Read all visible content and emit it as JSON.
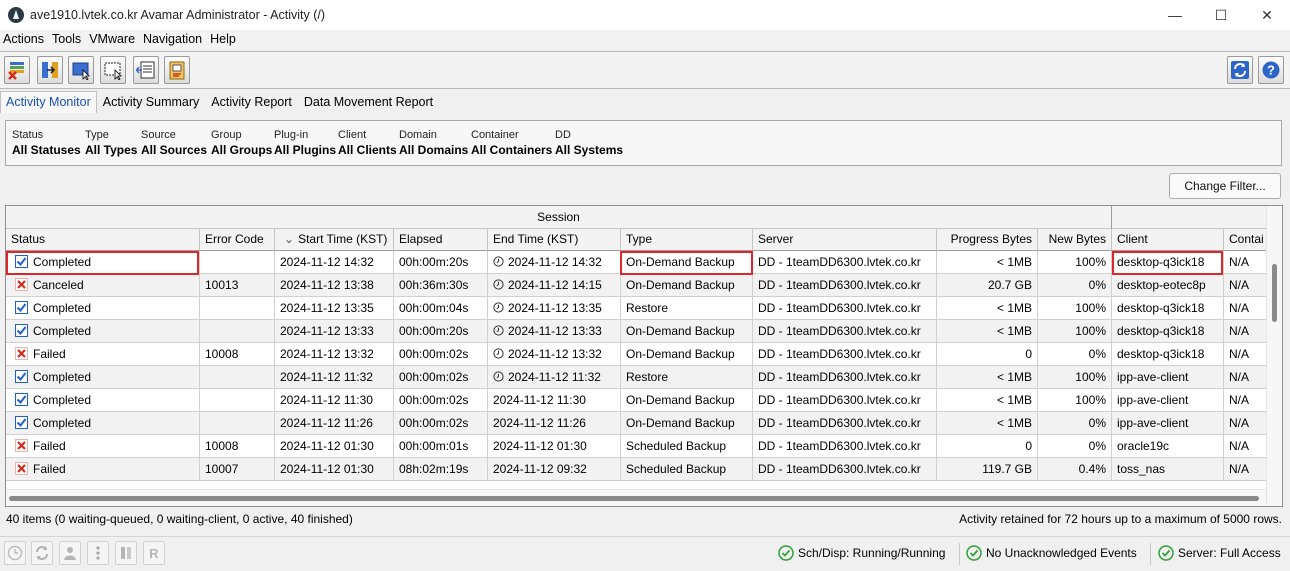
{
  "window": {
    "title": "ave1910.lvtek.co.kr Avamar Administrator - Activity (/)",
    "controls": {
      "minimize": "—",
      "maximize": "☐",
      "close": "✕"
    }
  },
  "menu": [
    "Actions",
    "Tools",
    "VMware",
    "Navigation",
    "Help"
  ],
  "toolbar": {
    "icons": [
      "cancel-activity-icon",
      "activity-details-icon",
      "select-all-icon",
      "select-none-icon",
      "session-log-icon",
      "get-log-icon",
      "refresh-icon",
      "help-icon"
    ]
  },
  "tabs": [
    "Activity Monitor",
    "Activity Summary",
    "Activity Report",
    "Data Movement Report"
  ],
  "filter": [
    {
      "label": "Status",
      "value": "All Statuses"
    },
    {
      "label": "Type",
      "value": "All Types"
    },
    {
      "label": "Source",
      "value": "All Sources"
    },
    {
      "label": "Group",
      "value": "All Groups"
    },
    {
      "label": "Plug-in",
      "value": "All Plugins"
    },
    {
      "label": "Client",
      "value": "All Clients"
    },
    {
      "label": "Domain",
      "value": "All Domains"
    },
    {
      "label": "Container",
      "value": "All Containers"
    },
    {
      "label": "DD",
      "value": "All Systems"
    }
  ],
  "change_filter_label": "Change Filter...",
  "table": {
    "group_header": "Session",
    "sort_indicator": "⌄",
    "columns": [
      "Status",
      "Error Code",
      "Start Time (KST)",
      "Elapsed",
      "End Time (KST)",
      "Type",
      "Server",
      "Progress Bytes",
      "New Bytes",
      "Client",
      "Contai"
    ],
    "rows": [
      {
        "status": "Completed",
        "icon": "check",
        "error": "",
        "start": "2024-11-12 14:32",
        "elapsed": "00h:00m:20s",
        "end": "2024-11-12 14:32",
        "clock": true,
        "type": "On-Demand Backup",
        "server": "DD - 1teamDD6300.lvtek.co.kr",
        "progress": "< 1MB",
        "newbytes": "100%",
        "client": "desktop-q3ick18",
        "container": "N/A"
      },
      {
        "status": "Canceled",
        "icon": "x",
        "error": "10013",
        "start": "2024-11-12 13:38",
        "elapsed": "00h:36m:30s",
        "end": "2024-11-12 14:15",
        "clock": true,
        "type": "On-Demand Backup",
        "server": "DD - 1teamDD6300.lvtek.co.kr",
        "progress": "20.7 GB",
        "newbytes": "0%",
        "client": "desktop-eotec8p",
        "container": "N/A"
      },
      {
        "status": "Completed",
        "icon": "check",
        "error": "",
        "start": "2024-11-12 13:35",
        "elapsed": "00h:00m:04s",
        "end": "2024-11-12 13:35",
        "clock": true,
        "type": "Restore",
        "server": "DD - 1teamDD6300.lvtek.co.kr",
        "progress": "< 1MB",
        "newbytes": "100%",
        "client": "desktop-q3ick18",
        "container": "N/A"
      },
      {
        "status": "Completed",
        "icon": "check",
        "error": "",
        "start": "2024-11-12 13:33",
        "elapsed": "00h:00m:20s",
        "end": "2024-11-12 13:33",
        "clock": true,
        "type": "On-Demand Backup",
        "server": "DD - 1teamDD6300.lvtek.co.kr",
        "progress": "< 1MB",
        "newbytes": "100%",
        "client": "desktop-q3ick18",
        "container": "N/A"
      },
      {
        "status": "Failed",
        "icon": "x",
        "error": "10008",
        "start": "2024-11-12 13:32",
        "elapsed": "00h:00m:02s",
        "end": "2024-11-12 13:32",
        "clock": true,
        "type": "On-Demand Backup",
        "server": "DD - 1teamDD6300.lvtek.co.kr",
        "progress": "0",
        "newbytes": "0%",
        "client": "desktop-q3ick18",
        "container": "N/A"
      },
      {
        "status": "Completed",
        "icon": "check",
        "error": "",
        "start": "2024-11-12 11:32",
        "elapsed": "00h:00m:02s",
        "end": "2024-11-12 11:32",
        "clock": true,
        "type": "Restore",
        "server": "DD - 1teamDD6300.lvtek.co.kr",
        "progress": "< 1MB",
        "newbytes": "100%",
        "client": "ipp-ave-client",
        "container": "N/A"
      },
      {
        "status": "Completed",
        "icon": "check",
        "error": "",
        "start": "2024-11-12 11:30",
        "elapsed": "00h:00m:02s",
        "end": "2024-11-12 11:30",
        "clock": false,
        "type": "On-Demand Backup",
        "server": "DD - 1teamDD6300.lvtek.co.kr",
        "progress": "< 1MB",
        "newbytes": "100%",
        "client": "ipp-ave-client",
        "container": "N/A"
      },
      {
        "status": "Completed",
        "icon": "check",
        "error": "",
        "start": "2024-11-12 11:26",
        "elapsed": "00h:00m:02s",
        "end": "2024-11-12 11:26",
        "clock": false,
        "type": "On-Demand Backup",
        "server": "DD - 1teamDD6300.lvtek.co.kr",
        "progress": "< 1MB",
        "newbytes": "0%",
        "client": "ipp-ave-client",
        "container": "N/A"
      },
      {
        "status": "Failed",
        "icon": "x",
        "error": "10008",
        "start": "2024-11-12 01:30",
        "elapsed": "00h:00m:01s",
        "end": "2024-11-12 01:30",
        "clock": false,
        "type": "Scheduled Backup",
        "server": "DD - 1teamDD6300.lvtek.co.kr",
        "progress": "0",
        "newbytes": "0%",
        "client": "oracle19c",
        "container": "N/A"
      },
      {
        "status": "Failed",
        "icon": "x",
        "error": "10007",
        "start": "2024-11-12 01:30",
        "elapsed": "08h:02m:19s",
        "end": "2024-11-12 09:32",
        "clock": false,
        "type": "Scheduled Backup",
        "server": "DD - 1teamDD6300.lvtek.co.kr",
        "progress": "119.7 GB",
        "newbytes": "0.4%",
        "client": "toss_nas",
        "container": "N/A"
      }
    ]
  },
  "summary": {
    "items": "40 items (0 waiting-queued, 0 waiting-client, 0 active, 40 finished)",
    "retained": "Activity retained for 72 hours up to a maximum of 5000 rows."
  },
  "status_bar": {
    "icons": [
      "clock-status-icon",
      "sync-icon",
      "user-icon",
      "vertical-dots-icon",
      "book-icon",
      "r-icon"
    ],
    "indicators": [
      "Sch/Disp: Running/Running",
      "No Unacknowledged Events",
      "Server: Full Access"
    ]
  },
  "colors": {
    "highlight": "#e0262b",
    "check": "#1f5fd0",
    "fail": "#d42b1e",
    "ok": "#2fa335"
  }
}
